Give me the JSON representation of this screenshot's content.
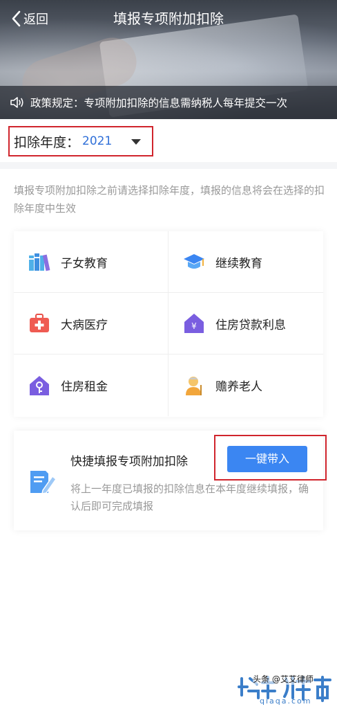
{
  "header": {
    "back_label": "返回",
    "title": "填报专项附加扣除",
    "notice": "政策规定：专项附加扣除的信息需纳税人每年提交一次"
  },
  "year": {
    "label": "扣除年度：",
    "value": "2021"
  },
  "tip": "填报专项附加扣除之前请选择扣除年度，填报的信息将会在选择的扣除年度中生效",
  "grid": [
    {
      "label": "子女教育",
      "icon": "books-icon"
    },
    {
      "label": "继续教育",
      "icon": "graduation-cap-icon"
    },
    {
      "label": "大病医疗",
      "icon": "medical-kit-icon"
    },
    {
      "label": "住房贷款利息",
      "icon": "house-yuan-icon"
    },
    {
      "label": "住房租金",
      "icon": "house-key-icon"
    },
    {
      "label": "赡养老人",
      "icon": "elder-person-icon"
    }
  ],
  "quick": {
    "title": "快捷填报专项附加扣除",
    "desc": "将上一年度已填报的扣除信息在本年度继续填报，确认后即可完成填报",
    "button": "一键带入"
  },
  "watermark": {
    "caption": "头条 @艾艾律师",
    "url": "qiaqa.com"
  },
  "colors": {
    "accent_blue": "#3b86f2",
    "highlight_red": "#d0242c",
    "year_blue": "#2f6fd8"
  }
}
